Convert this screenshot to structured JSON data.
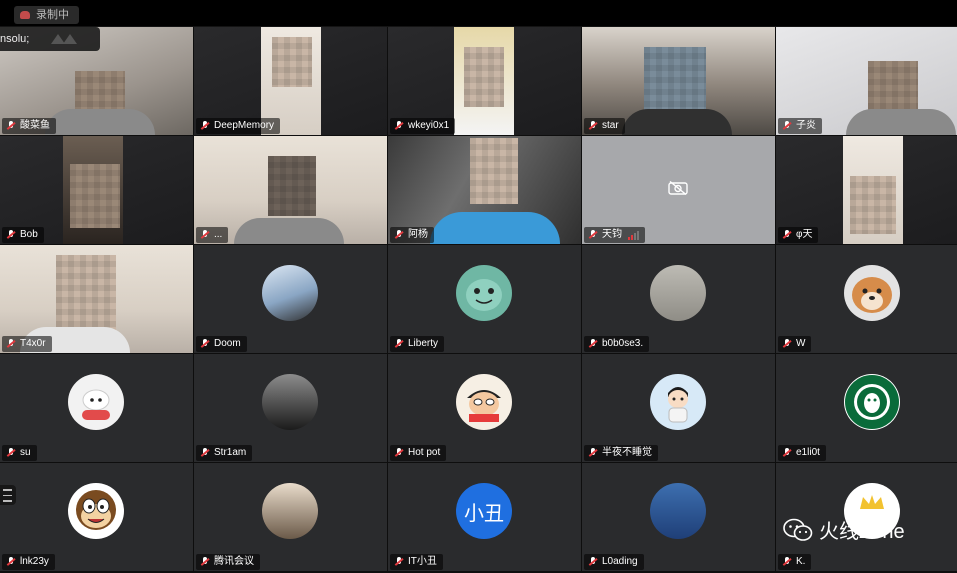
{
  "window": {
    "recording_label": "录制中",
    "overlay_label": "nsolu;"
  },
  "tiles": [
    {
      "name": "酸菜鱼"
    },
    {
      "name": "DeepMemory"
    },
    {
      "name": "wkeyi0x1"
    },
    {
      "name": "star"
    },
    {
      "name": "子炎"
    },
    {
      "name": "Bob"
    },
    {
      "name": "..."
    },
    {
      "name": "阿杨"
    },
    {
      "name": "天钧"
    },
    {
      "name": "φ天"
    },
    {
      "name": "T4x0r"
    },
    {
      "name": "Doom"
    },
    {
      "name": "Liberty"
    },
    {
      "name": "b0b0se3."
    },
    {
      "name": "W"
    },
    {
      "name": "su"
    },
    {
      "name": "Str1am"
    },
    {
      "name": "Hot pot"
    },
    {
      "name": "半夜不睡觉"
    },
    {
      "name": "e1li0t"
    },
    {
      "name": "lnk23y"
    },
    {
      "name": "腾讯会议"
    },
    {
      "name": "IT小丑"
    },
    {
      "name": "L0ading"
    },
    {
      "name": "K."
    }
  ],
  "avatars": {
    "it_clown_text": "小丑",
    "starbucks_text": "GNU/LINUX FREEDOM"
  },
  "watermark": {
    "text": "火线Zone"
  },
  "colors": {
    "mic_muted": "#e0393e",
    "tile_bg": "#2a2b2d",
    "it_clown_avatar": "#1f6fe0"
  }
}
